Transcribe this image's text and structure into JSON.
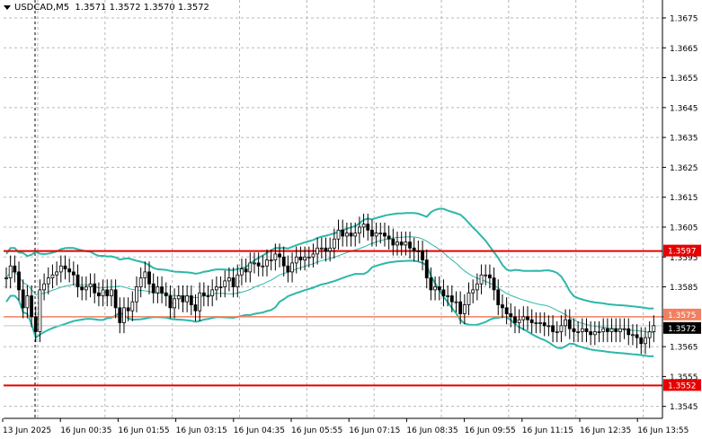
{
  "header": {
    "symbol_label": "USDCAD,M5",
    "ohlc_text": "1.3571 1.3572 1.3570 1.3572"
  },
  "price_labels": [
    {
      "value": "1.3597",
      "kind": "level",
      "color": "#e60000"
    },
    {
      "value": "1.3575",
      "kind": "level",
      "color": "#f08060"
    },
    {
      "value": "1.3572",
      "kind": "current",
      "color": "#000000"
    },
    {
      "value": "1.3552",
      "kind": "level",
      "color": "#e60000"
    }
  ],
  "colors": {
    "grid": "#b8b8b8",
    "bands": "#2cb8a8",
    "support_resistance": "#e60000",
    "level_secondary": "#f08060",
    "candles": "#000000",
    "background": "#ffffff"
  },
  "chart_data": {
    "type": "candlestick",
    "symbol": "USDCAD",
    "timeframe": "M5",
    "ylim": [
      1.3541,
      1.3681
    ],
    "y_ticks": [
      "1.3675",
      "1.3665",
      "1.3655",
      "1.3645",
      "1.3635",
      "1.3625",
      "1.3615",
      "1.3605",
      "1.3595",
      "1.3585",
      "1.3575",
      "1.3565",
      "1.3555",
      "1.3545"
    ],
    "x_ticks": [
      "13 Jun 2025",
      "16 Jun 00:35",
      "16 Jun 01:55",
      "16 Jun 03:15",
      "16 Jun 04:35",
      "16 Jun 05:55",
      "16 Jun 07:15",
      "16 Jun 08:35",
      "16 Jun 09:55",
      "16 Jun 11:15",
      "16 Jun 12:35",
      "16 Jun 13:55"
    ],
    "x_tick_index": [
      0,
      16,
      32,
      48,
      64,
      80,
      96,
      112,
      128,
      144,
      160,
      176
    ],
    "horizontal_lines": [
      1.3597,
      1.3552
    ],
    "current_price": 1.3572,
    "closes": [
      1.3588,
      1.3592,
      1.359,
      1.3584,
      1.3578,
      1.3582,
      1.3575,
      1.357,
      1.3584,
      1.3586,
      1.3588,
      1.3589,
      1.359,
      1.3592,
      1.3591,
      1.359,
      1.3589,
      1.3585,
      1.3584,
      1.3585,
      1.3586,
      1.3583,
      1.3582,
      1.3584,
      1.3582,
      1.3584,
      1.3578,
      1.3573,
      1.3578,
      1.3577,
      1.358,
      1.3585,
      1.3588,
      1.359,
      1.3586,
      1.3583,
      1.3585,
      1.3583,
      1.3582,
      1.3578,
      1.3581,
      1.3582,
      1.358,
      1.3582,
      1.3579,
      1.3577,
      1.3583,
      1.3582,
      1.3582,
      1.3584,
      1.3585,
      1.3585,
      1.3587,
      1.3588,
      1.3585,
      1.3589,
      1.3591,
      1.359,
      1.3593,
      1.3593,
      1.3592,
      1.3592,
      1.3594,
      1.3594,
      1.3596,
      1.3595,
      1.3592,
      1.359,
      1.3593,
      1.3595,
      1.3594,
      1.3595,
      1.3595,
      1.3596,
      1.3598,
      1.3598,
      1.3597,
      1.3598,
      1.3601,
      1.3604,
      1.3602,
      1.3603,
      1.3602,
      1.3603,
      1.3605,
      1.3606,
      1.3604,
      1.3602,
      1.3603,
      1.3603,
      1.3602,
      1.3601,
      1.3599,
      1.36,
      1.3599,
      1.36,
      1.3598,
      1.3597,
      1.3597,
      1.3594,
      1.3588,
      1.3584,
      1.3585,
      1.3584,
      1.3582,
      1.3582,
      1.358,
      1.358,
      1.3576,
      1.3579,
      1.3583,
      1.3584,
      1.3586,
      1.3589,
      1.3589,
      1.3588,
      1.3584,
      1.3579,
      1.3578,
      1.3576,
      1.3575,
      1.3573,
      1.3574,
      1.3575,
      1.3574,
      1.3573,
      1.3573,
      1.3573,
      1.3572,
      1.3572,
      1.357,
      1.357,
      1.3572,
      1.3574,
      1.3571,
      1.357,
      1.357,
      1.3571,
      1.357,
      1.3569,
      1.357,
      1.357,
      1.3571,
      1.357,
      1.3571,
      1.357,
      1.3571,
      1.3571,
      1.3569,
      1.3569,
      1.3568,
      1.3566,
      1.3568,
      1.357,
      1.3572
    ]
  }
}
